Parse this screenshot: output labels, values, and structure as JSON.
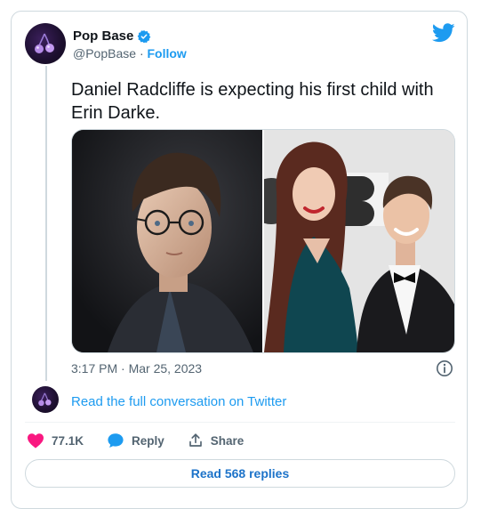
{
  "tweet": {
    "author": {
      "name": "Pop Base",
      "handle": "@PopBase",
      "separator": "·",
      "follow_label": "Follow",
      "verified_icon": "verified-badge-icon",
      "avatar_icon": "cherry-logo-icon"
    },
    "text": "Daniel Radcliffe is expecting his first child with Erin Darke.",
    "media": [
      {
        "icon": "photo-portrait-left"
      },
      {
        "icon": "photo-couple-right"
      }
    ],
    "timestamp": "3:17 PM · Mar 25, 2023",
    "read_conversation": "Read the full conversation on Twitter",
    "actions": {
      "likes": "77.1K",
      "reply_label": "Reply",
      "share_label": "Share"
    },
    "read_replies": "Read 568 replies"
  },
  "colors": {
    "accent": "#1d9bf0",
    "like": "#f91880",
    "text": "#0f1419",
    "muted": "#536471",
    "border": "#cfd9de"
  }
}
